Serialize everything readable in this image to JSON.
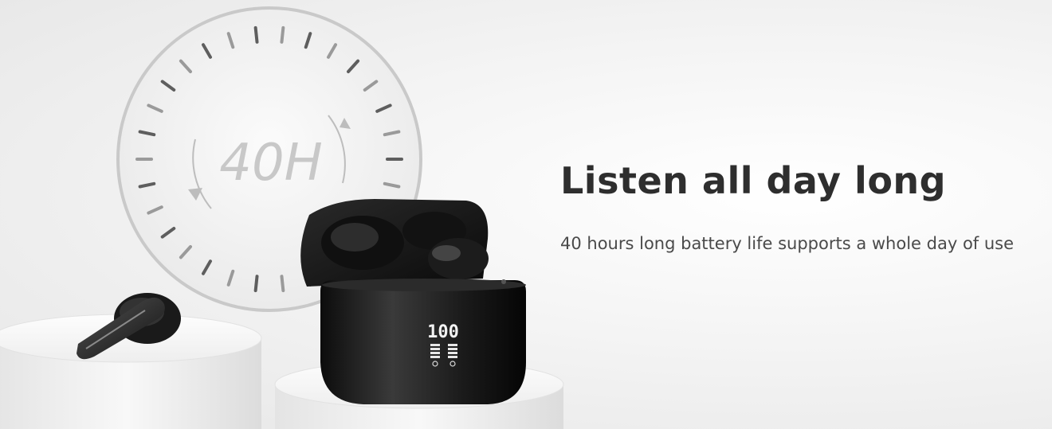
{
  "hero": {
    "dial_label": "40H",
    "headline": "Listen all day long",
    "subline": "40 hours long battery life supports a whole day of use"
  },
  "case_display": {
    "battery_percent": "100"
  }
}
